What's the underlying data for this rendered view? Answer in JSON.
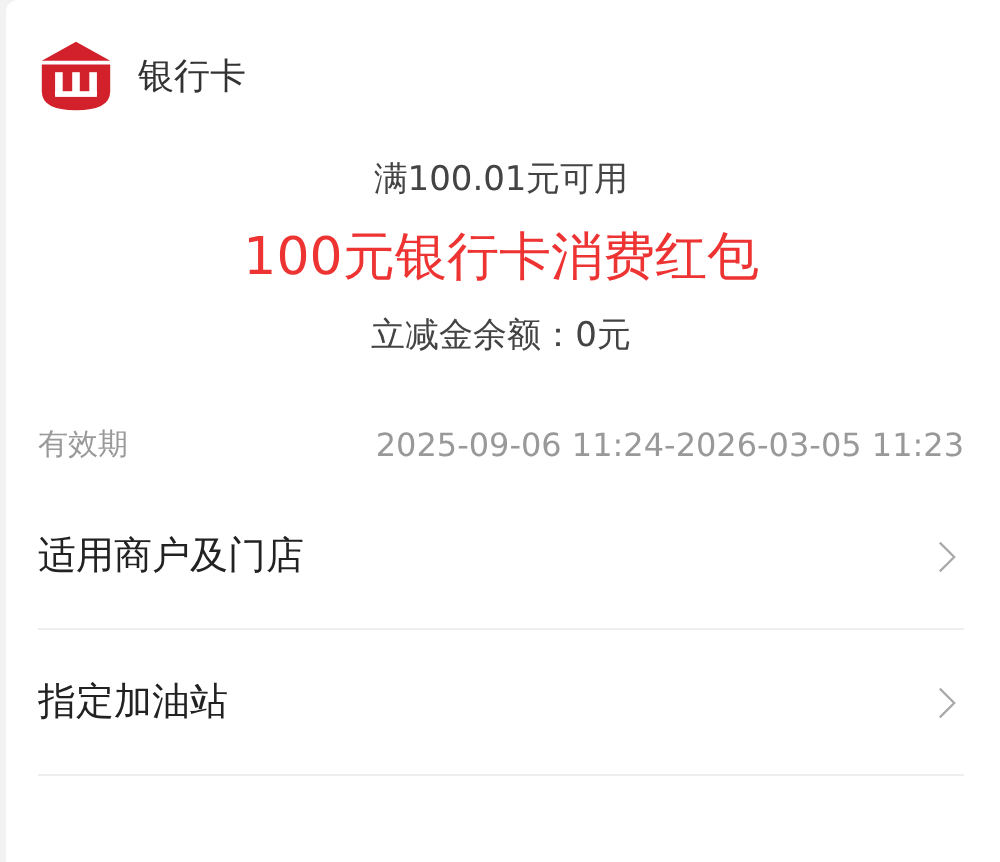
{
  "header": {
    "title": "银行卡"
  },
  "coupon": {
    "condition": "满100.01元可用",
    "name": "100元银行卡消费红包",
    "balance": "立减金余额：0元"
  },
  "validity": {
    "label": "有效期",
    "value": "2025-09-06 11:24-2026-03-05 11:23"
  },
  "links": [
    {
      "label": "适用商户及门店"
    },
    {
      "label": "指定加油站"
    }
  ]
}
